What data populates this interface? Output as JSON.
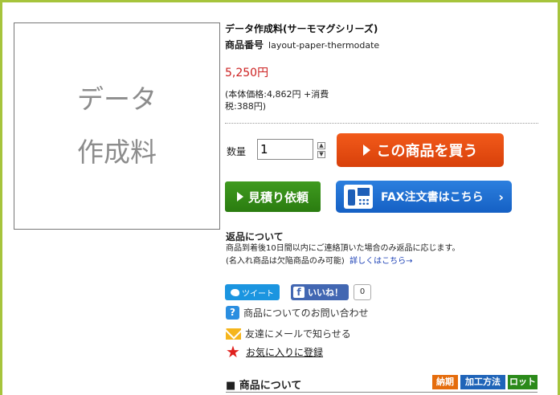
{
  "product": {
    "image_placeholder_line1": "データ",
    "image_placeholder_line2": "作成料",
    "title": "データ作成料(サーモマグシリーズ)",
    "code_label": "商品番号",
    "code_value": "layout-paper-thermodate",
    "price": "5,250円",
    "price_breakdown": "(本体価格:4,862円 +消費税:388円)"
  },
  "purchase": {
    "quantity_label": "数量",
    "quantity_value": "1",
    "stepper_up": "▲",
    "stepper_down": "▼",
    "buy_label": "この商品を買う",
    "quote_label": "見積り依頼",
    "fax_label": "FAX注文書はこちら",
    "fax_chevron": "›"
  },
  "returns": {
    "title": "返品について",
    "line1": "商品到着後10日間以内にご連絡頂いた場合のみ返品に応じます。",
    "line2": "(名入れ商品は欠陥商品のみ可能)",
    "link": "詳しくはこちら→"
  },
  "social": {
    "tweet_label": "ツイート",
    "fb_letter": "f",
    "like_label": "いいね！",
    "like_count": "0"
  },
  "links": {
    "inquiry": "商品についてのお問い合わせ",
    "inquiry_icon": "?",
    "share_mail": "友達にメールで知らせる",
    "favorite": "お気に入りに登録",
    "star_glyph": "★"
  },
  "section": {
    "title": "■ 商品について",
    "tags": [
      "納期",
      "加工方法",
      "ロット"
    ]
  },
  "colors": {
    "frame": "#a6c43c",
    "price": "#cc1f1f",
    "buy": "#e04a12",
    "quote": "#2f8a17",
    "fax": "#1e6fd4"
  }
}
